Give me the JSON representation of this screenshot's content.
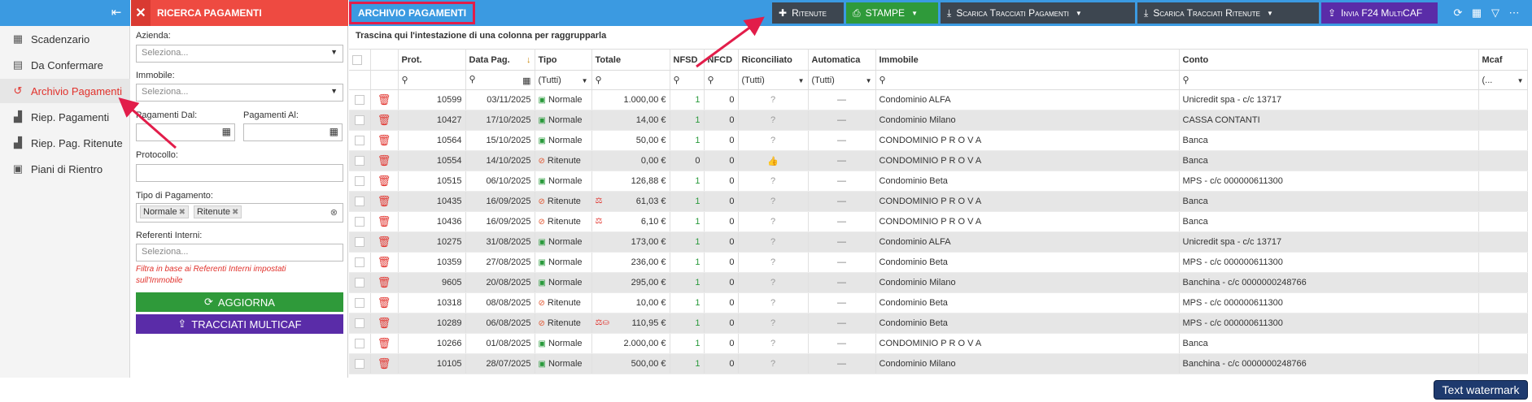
{
  "nav": {
    "items": [
      {
        "label": "Scadenzario",
        "icon": "calendar-icon"
      },
      {
        "label": "Da Confermare",
        "icon": "money-icon"
      },
      {
        "label": "Archivio Pagamenti",
        "icon": "history-icon"
      },
      {
        "label": "Riep. Pagamenti",
        "icon": "chart-icon"
      },
      {
        "label": "Riep. Pag. Ritenute",
        "icon": "chart-icon"
      },
      {
        "label": "Piani di Rientro",
        "icon": "calendar-clock-icon"
      }
    ]
  },
  "search": {
    "title": "RICERCA PAGAMENTI",
    "azienda_label": "Azienda:",
    "azienda_value": "Seleziona...",
    "immobile_label": "Immobile:",
    "immobile_value": "Seleziona...",
    "dal_label": "Pagamenti Dal:",
    "al_label": "Pagamenti Al:",
    "protocollo_label": "Protocollo:",
    "tipo_label": "Tipo di Pagamento:",
    "tipo_chips": [
      "Normale",
      "Ritenute"
    ],
    "referenti_label": "Referenti Interni:",
    "referenti_value": "Seleziona...",
    "hint": "Filtra in base ai Referenti Interni impostati sull'Immobile",
    "aggiorna_label": "AGGIORNA",
    "tracciati_label": "TRACCIATI MULTICAF"
  },
  "toolbar": {
    "title": "ARCHIVIO PAGAMENTI",
    "ritenute_label": "Ritenute",
    "stampe_label": "STAMPE",
    "scarica_pagamenti_label": "Scarica Tracciati Pagamenti",
    "scarica_ritenute_label": "Scarica Tracciati Ritenute",
    "invia_label": "Invia F24 MultiCAF"
  },
  "grid": {
    "group_hint": "Trascina qui l'intestazione di una colonna per raggrupparla",
    "columns": [
      "Prot.",
      "Data Pag.",
      "Tipo",
      "Totale",
      "NFSD",
      "NFCD",
      "Riconciliato",
      "Automatica",
      "Immobile",
      "Conto",
      "Mcaf"
    ],
    "filters": {
      "tipo": "(Tutti)",
      "riconciliato": "(Tutti)",
      "automatica": "(Tutti)",
      "mcaf": "(..."
    },
    "rows": [
      {
        "prot": "10599",
        "data": "03/11/2025",
        "tipo": "Normale",
        "flags": "",
        "totale": "1.000,00 €",
        "nfsd": "1",
        "nfcd": "0",
        "ric": "?",
        "auto": "—",
        "immobile": "Condominio ALFA",
        "conto": "Unicredit spa - c/c 13717"
      },
      {
        "prot": "10427",
        "data": "17/10/2025",
        "tipo": "Normale",
        "flags": "",
        "totale": "14,00 €",
        "nfsd": "1",
        "nfcd": "0",
        "ric": "?",
        "auto": "—",
        "immobile": "Condominio Milano",
        "conto": "CASSA CONTANTI"
      },
      {
        "prot": "10564",
        "data": "15/10/2025",
        "tipo": "Normale",
        "flags": "",
        "totale": "50,00 €",
        "nfsd": "1",
        "nfcd": "0",
        "ric": "?",
        "auto": "—",
        "immobile": "CONDOMINIO P R O V A",
        "conto": "Banca"
      },
      {
        "prot": "10554",
        "data": "14/10/2025",
        "tipo": "Ritenute",
        "flags": "",
        "totale": "0,00 €",
        "nfsd": "0",
        "nfcd": "0",
        "ric": "thumb",
        "auto": "—",
        "immobile": "CONDOMINIO P R O V A",
        "conto": "Banca"
      },
      {
        "prot": "10515",
        "data": "06/10/2025",
        "tipo": "Normale",
        "flags": "",
        "totale": "126,88 €",
        "nfsd": "1",
        "nfcd": "0",
        "ric": "?",
        "auto": "—",
        "immobile": "Condominio Beta",
        "conto": "MPS - c/c 000000611300"
      },
      {
        "prot": "10435",
        "data": "16/09/2025",
        "tipo": "Ritenute",
        "flags": "⚖",
        "totale": "61,03 €",
        "nfsd": "1",
        "nfcd": "0",
        "ric": "?",
        "auto": "—",
        "immobile": "CONDOMINIO P R O V A",
        "conto": "Banca"
      },
      {
        "prot": "10436",
        "data": "16/09/2025",
        "tipo": "Ritenute",
        "flags": "⚖",
        "totale": "6,10 €",
        "nfsd": "1",
        "nfcd": "0",
        "ric": "?",
        "auto": "—",
        "immobile": "CONDOMINIO P R O V A",
        "conto": "Banca"
      },
      {
        "prot": "10275",
        "data": "31/08/2025",
        "tipo": "Normale",
        "flags": "",
        "totale": "173,00 €",
        "nfsd": "1",
        "nfcd": "0",
        "ric": "?",
        "auto": "—",
        "immobile": "Condominio ALFA",
        "conto": "Unicredit spa - c/c 13717"
      },
      {
        "prot": "10359",
        "data": "27/08/2025",
        "tipo": "Normale",
        "flags": "",
        "totale": "236,00 €",
        "nfsd": "1",
        "nfcd": "0",
        "ric": "?",
        "auto": "—",
        "immobile": "Condominio Beta",
        "conto": "MPS - c/c 000000611300"
      },
      {
        "prot": "9605",
        "data": "20/08/2025",
        "tipo": "Normale",
        "flags": "",
        "totale": "295,00 €",
        "nfsd": "1",
        "nfcd": "0",
        "ric": "?",
        "auto": "—",
        "immobile": "Condominio Milano",
        "conto": "Banchina - c/c 0000000248766"
      },
      {
        "prot": "10318",
        "data": "08/08/2025",
        "tipo": "Ritenute",
        "flags": "",
        "totale": "10,00 €",
        "nfsd": "1",
        "nfcd": "0",
        "ric": "?",
        "auto": "—",
        "immobile": "Condominio Beta",
        "conto": "MPS - c/c 000000611300"
      },
      {
        "prot": "10289",
        "data": "06/08/2025",
        "tipo": "Ritenute",
        "flags": "⚖⛀",
        "totale": "110,95 €",
        "nfsd": "1",
        "nfcd": "0",
        "ric": "?",
        "auto": "—",
        "immobile": "Condominio Beta",
        "conto": "MPS - c/c 000000611300"
      },
      {
        "prot": "10266",
        "data": "01/08/2025",
        "tipo": "Normale",
        "flags": "",
        "totale": "2.000,00 €",
        "nfsd": "1",
        "nfcd": "0",
        "ric": "?",
        "auto": "—",
        "immobile": "CONDOMINIO P R O V A",
        "conto": "Banca"
      },
      {
        "prot": "10105",
        "data": "28/07/2025",
        "tipo": "Normale",
        "flags": "",
        "totale": "500,00 €",
        "nfsd": "1",
        "nfcd": "0",
        "ric": "?",
        "auto": "—",
        "immobile": "Condominio Milano",
        "conto": "Banchina - c/c 0000000248766"
      }
    ]
  },
  "watermark": "Text watermark",
  "colors": {
    "accent": "#3b9ae1",
    "search_header": "#ee4a41",
    "annotation": "#e21d4a",
    "aggiorna": "#2f9a3a",
    "tracciati": "#5a2ca8"
  }
}
